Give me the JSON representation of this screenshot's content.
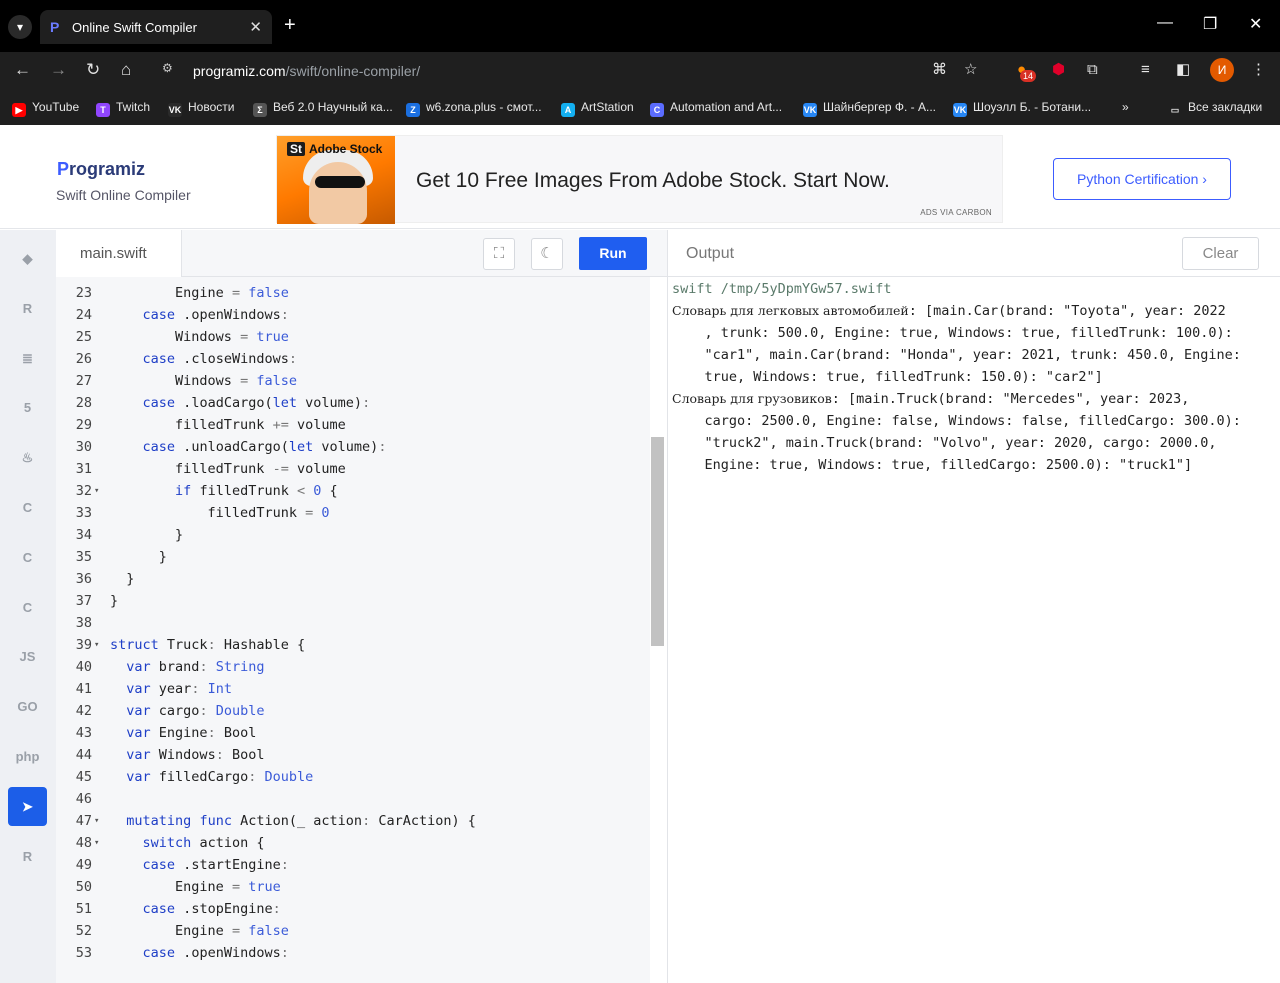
{
  "browser": {
    "tab_title": "Online Swift Compiler",
    "url_host": "programiz.com",
    "url_path": "/swift/online-compiler/",
    "profile_letter": "И",
    "extension_badge": "14"
  },
  "bookmarks": [
    {
      "label": "YouTube",
      "color": "#ff0000",
      "glyph": "▶"
    },
    {
      "label": "Twitch",
      "color": "#9146ff",
      "glyph": "T"
    },
    {
      "label": "Новости",
      "color": "#2a2a2a",
      "glyph": "VK"
    },
    {
      "label": "Веб 2.0 Научный ка...",
      "color": "#555555",
      "glyph": "Σ"
    },
    {
      "label": "w6.zona.plus - смот...",
      "color": "#1b6fe0",
      "glyph": "Z"
    },
    {
      "label": "ArtStation",
      "color": "#13aff0",
      "glyph": "A"
    },
    {
      "label": "Automation and Art...",
      "color": "#5b6cff",
      "glyph": "C"
    },
    {
      "label": "Шайнбергер Ф. - А...",
      "color": "#2787f5",
      "glyph": "VK"
    },
    {
      "label": "Шоуэлл Б. - Ботани...",
      "color": "#2787f5",
      "glyph": "VK"
    },
    {
      "label": "»",
      "color": "",
      "glyph": ""
    },
    {
      "label": "Все закладки",
      "color": "",
      "glyph": "▭"
    }
  ],
  "header": {
    "logo_p": "P",
    "logo_rest": "rogramiz",
    "subtitle": "Swift Online Compiler",
    "ad_brand": "Adobe Stock",
    "ad_brand_badge": "St",
    "ad_text": "Get 10 Free Images From Adobe Stock. Start Now.",
    "ad_via": "ADS VIA CARBON",
    "cert_button": "Python Certification ›"
  },
  "sidebar": {
    "languages": [
      {
        "name": "python",
        "glyph": "◆"
      },
      {
        "name": "r",
        "glyph": "R"
      },
      {
        "name": "sql",
        "glyph": "≣"
      },
      {
        "name": "html",
        "glyph": "5"
      },
      {
        "name": "java",
        "glyph": "♨"
      },
      {
        "name": "c",
        "glyph": "C"
      },
      {
        "name": "cpp",
        "glyph": "C"
      },
      {
        "name": "csharp",
        "glyph": "C"
      },
      {
        "name": "js",
        "glyph": "JS"
      },
      {
        "name": "go",
        "glyph": "GO"
      },
      {
        "name": "php",
        "glyph": "php"
      },
      {
        "name": "swift",
        "glyph": "➤"
      },
      {
        "name": "rust",
        "glyph": "R"
      }
    ]
  },
  "editor": {
    "file_name": "main.swift",
    "run_label": "Run",
    "lines": [
      {
        "n": "23",
        "fold": "",
        "text": "        Engine = false"
      },
      {
        "n": "24",
        "fold": "",
        "text": "    case .openWindows:"
      },
      {
        "n": "25",
        "fold": "",
        "text": "        Windows = true"
      },
      {
        "n": "26",
        "fold": "",
        "text": "    case .closeWindows:"
      },
      {
        "n": "27",
        "fold": "",
        "text": "        Windows = false"
      },
      {
        "n": "28",
        "fold": "",
        "text": "    case .loadCargo(let volume):"
      },
      {
        "n": "29",
        "fold": "",
        "text": "        filledTrunk += volume"
      },
      {
        "n": "30",
        "fold": "",
        "text": "    case .unloadCargo(let volume):"
      },
      {
        "n": "31",
        "fold": "",
        "text": "        filledTrunk -= volume"
      },
      {
        "n": "32",
        "fold": "▾",
        "text": "        if filledTrunk < 0 {"
      },
      {
        "n": "33",
        "fold": "",
        "text": "            filledTrunk = 0"
      },
      {
        "n": "34",
        "fold": "",
        "text": "        }"
      },
      {
        "n": "35",
        "fold": "",
        "text": "      }"
      },
      {
        "n": "36",
        "fold": "",
        "text": "  }"
      },
      {
        "n": "37",
        "fold": "",
        "text": "}"
      },
      {
        "n": "38",
        "fold": "",
        "text": ""
      },
      {
        "n": "39",
        "fold": "▾",
        "text": "struct Truck: Hashable {"
      },
      {
        "n": "40",
        "fold": "",
        "text": "  var brand: String"
      },
      {
        "n": "41",
        "fold": "",
        "text": "  var year: Int"
      },
      {
        "n": "42",
        "fold": "",
        "text": "  var cargo: Double"
      },
      {
        "n": "43",
        "fold": "",
        "text": "  var Engine: Bool"
      },
      {
        "n": "44",
        "fold": "",
        "text": "  var Windows: Bool"
      },
      {
        "n": "45",
        "fold": "",
        "text": "  var filledCargo: Double"
      },
      {
        "n": "46",
        "fold": "",
        "text": ""
      },
      {
        "n": "47",
        "fold": "▾",
        "text": "  mutating func Action(_ action: CarAction) {"
      },
      {
        "n": "48",
        "fold": "▾",
        "text": "    switch action {"
      },
      {
        "n": "49",
        "fold": "",
        "text": "    case .startEngine:"
      },
      {
        "n": "50",
        "fold": "",
        "text": "        Engine = true"
      },
      {
        "n": "51",
        "fold": "",
        "text": "    case .stopEngine:"
      },
      {
        "n": "52",
        "fold": "",
        "text": "        Engine = false"
      },
      {
        "n": "53",
        "fold": "",
        "text": "    case .openWindows:"
      }
    ]
  },
  "output": {
    "label": "Output",
    "clear_label": "Clear",
    "command": "swift /tmp/5yDpmYGw57.swift",
    "lines": [
      {
        "cyr": "Словарь для легковых автомобилей",
        "text": ": [main.Car(brand: \"Toyota\", year: 2022"
      },
      {
        "cyr": "",
        "text": "    , trunk: 500.0, Engine: true, Windows: true, filledTrunk: 100.0):"
      },
      {
        "cyr": "",
        "text": "    \"car1\", main.Car(brand: \"Honda\", year: 2021, trunk: 450.0, Engine:"
      },
      {
        "cyr": "",
        "text": "    true, Windows: true, filledTrunk: 150.0): \"car2\"]"
      },
      {
        "cyr": "Словарь для грузовиков",
        "text": ": [main.Truck(brand: \"Mercedes\", year: 2023,"
      },
      {
        "cyr": "",
        "text": "    cargo: 2500.0, Engine: false, Windows: false, filledCargo: 300.0):"
      },
      {
        "cyr": "",
        "text": "    \"truck2\", main.Truck(brand: \"Volvo\", year: 2020, cargo: 2000.0,"
      },
      {
        "cyr": "",
        "text": "    Engine: true, Windows: true, filledCargo: 2500.0): \"truck1\"]"
      }
    ]
  }
}
